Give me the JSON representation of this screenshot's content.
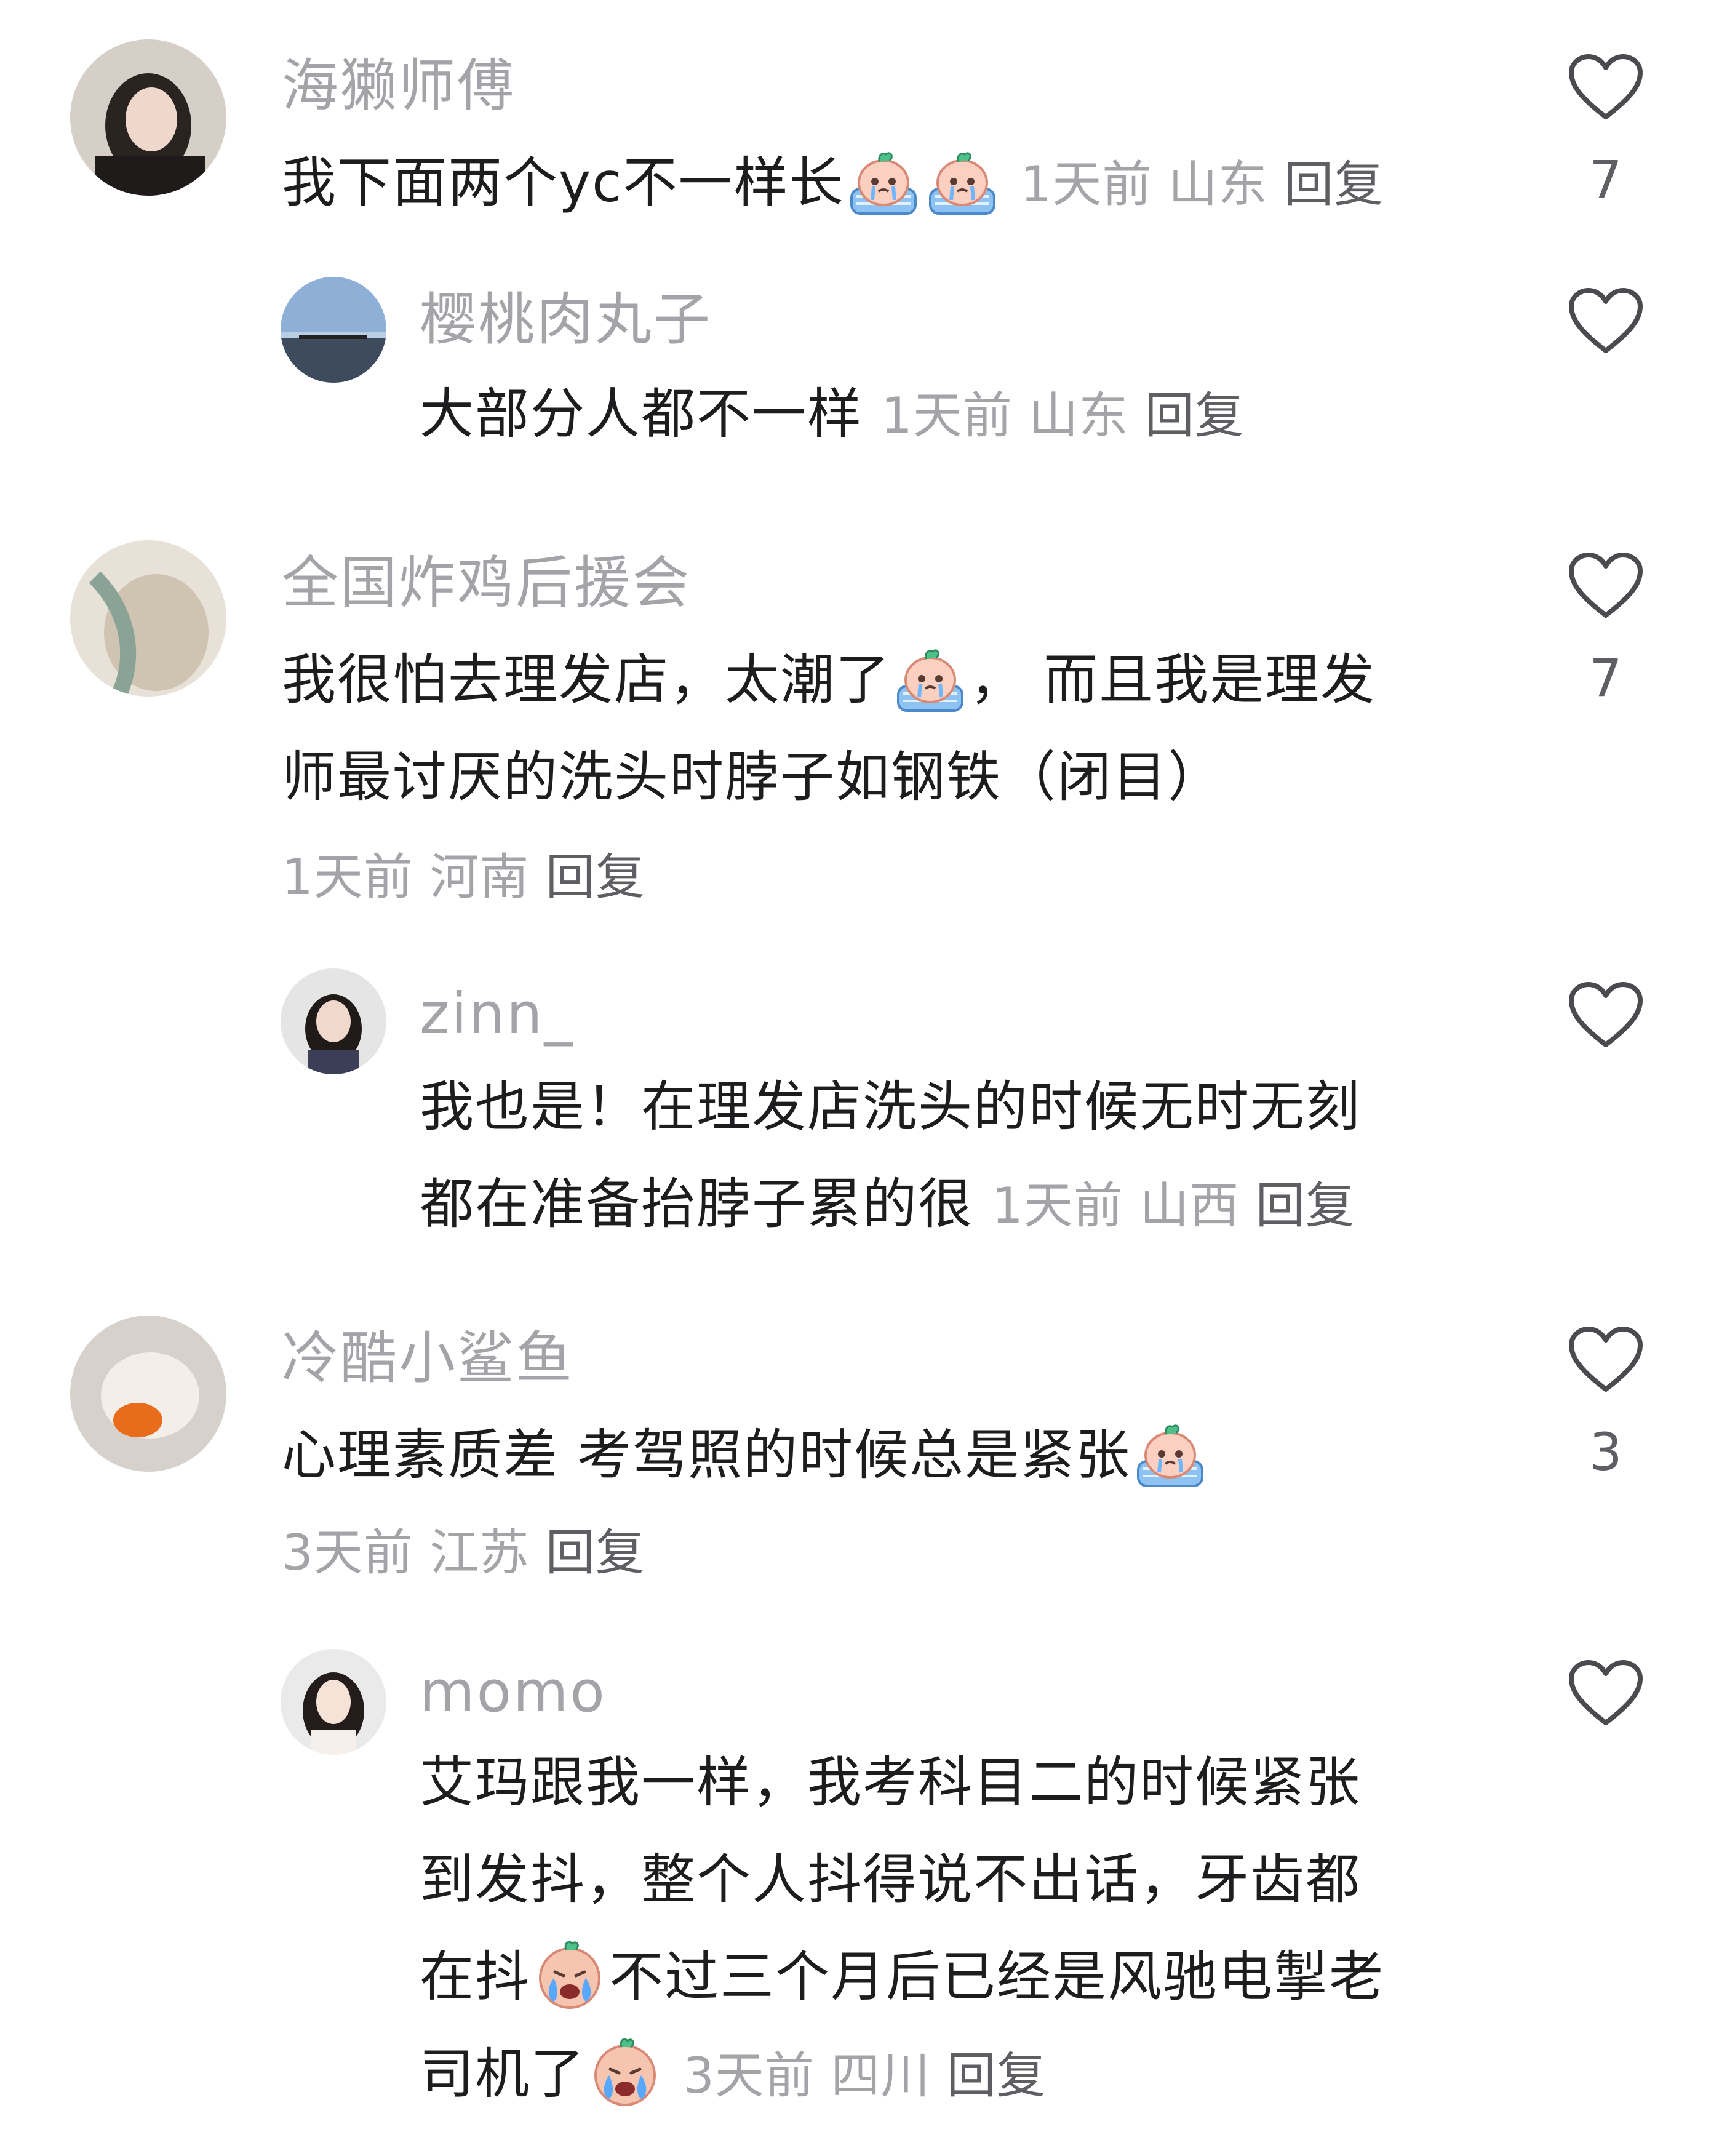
{
  "comments": [
    {
      "username": "海獭师傅",
      "text_before_emoji": "我下面两个yc不一样长",
      "time": "1天前",
      "location": "山东",
      "reply_label": "回复",
      "likes": "7",
      "emoji": "crying-peach-emoji",
      "replies": [
        {
          "username": "樱桃肉丸子",
          "text": "大部分人都不一样",
          "time": "1天前",
          "location": "山东",
          "reply_label": "回复"
        }
      ]
    },
    {
      "username": "全国炸鸡后援会",
      "text_line1_before_emoji": "我很怕去理发店，太潮了",
      "text_line1_after_emoji": "，  而且我是理发",
      "text_line2": "师最讨厌的洗头时脖子如钢铁（闭目）",
      "time": "1天前",
      "location": "河南",
      "reply_label": "回复",
      "likes": "7",
      "replies": [
        {
          "username": "zinn_",
          "text_line1": "我也是！在理发店洗头的时候无时无刻",
          "text_line2": "都在准备抬脖子累的很",
          "time": "1天前",
          "location": "山西",
          "reply_label": "回复"
        }
      ]
    },
    {
      "username": "冷酷小鲨鱼",
      "text_before_emoji": "心理素质差 考驾照的时候总是紧张",
      "time": "3天前",
      "location": "江苏",
      "reply_label": "回复",
      "likes": "3",
      "replies": [
        {
          "username": "momo",
          "text_line1": "艾玛跟我一样，我考科目二的时候紧张",
          "text_line2": "到发抖，整个人抖得说不出话，牙齿都",
          "text_line3_before_emoji": "在抖",
          "text_line3_after_emoji": "不过三个月后已经是风驰电掣老",
          "text_line4": "司机了",
          "time": "3天前",
          "location": "四川",
          "reply_label": "回复"
        }
      ]
    }
  ],
  "colors": {
    "text": "#1d1d1f",
    "muted": "#a3a3a8",
    "reply": "#5e5e63",
    "heart_stroke": "#4a4a4f"
  }
}
